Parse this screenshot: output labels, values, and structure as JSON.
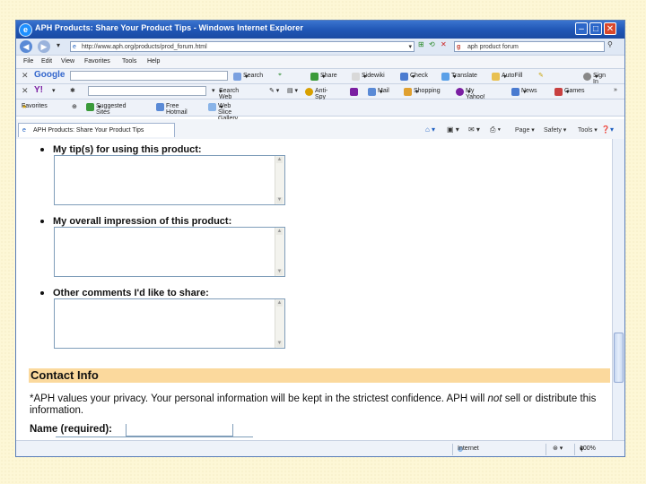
{
  "window": {
    "title": "APH Products: Share Your Product Tips - Windows Internet Explorer"
  },
  "address_bar": {
    "url": "http://www.aph.org/products/prod_forum.html",
    "search_value": "aph product forum"
  },
  "menu": [
    "File",
    "Edit",
    "View",
    "Favorites",
    "Tools",
    "Help"
  ],
  "google_toolbar": {
    "logo": "Google",
    "items": [
      "Search",
      "Share",
      "Sidewiki",
      "Check",
      "Translate",
      "AutoFill",
      "Sign In"
    ]
  },
  "yahoo_toolbar": {
    "logo": "Y!",
    "items": [
      "Search Web",
      "Anti-Spy",
      "Mail",
      "Shopping",
      "My Yahoo!",
      "News",
      "Games"
    ]
  },
  "favorites_bar": {
    "label": "Favorites",
    "items": [
      "Suggested Sites",
      "Free Hotmail",
      "Web Slice Gallery"
    ]
  },
  "tab": {
    "label": "APH Products: Share Your Product Tips",
    "right_items": [
      "Page",
      "Safety",
      "Tools"
    ]
  },
  "form": {
    "questions": [
      "My tip(s) for using this product:",
      "My overall impression of this product:",
      "Other comments I'd like to share:"
    ],
    "contact_heading": "Contact Info",
    "privacy_before": "*APH values your privacy. Your personal information will be kept in the strictest confidence. APH will ",
    "privacy_em": "not",
    "privacy_after": " sell or distribute this information.",
    "name_label": "Name (required):"
  },
  "status_bar": {
    "zone": "Internet",
    "zoom": "100%"
  }
}
